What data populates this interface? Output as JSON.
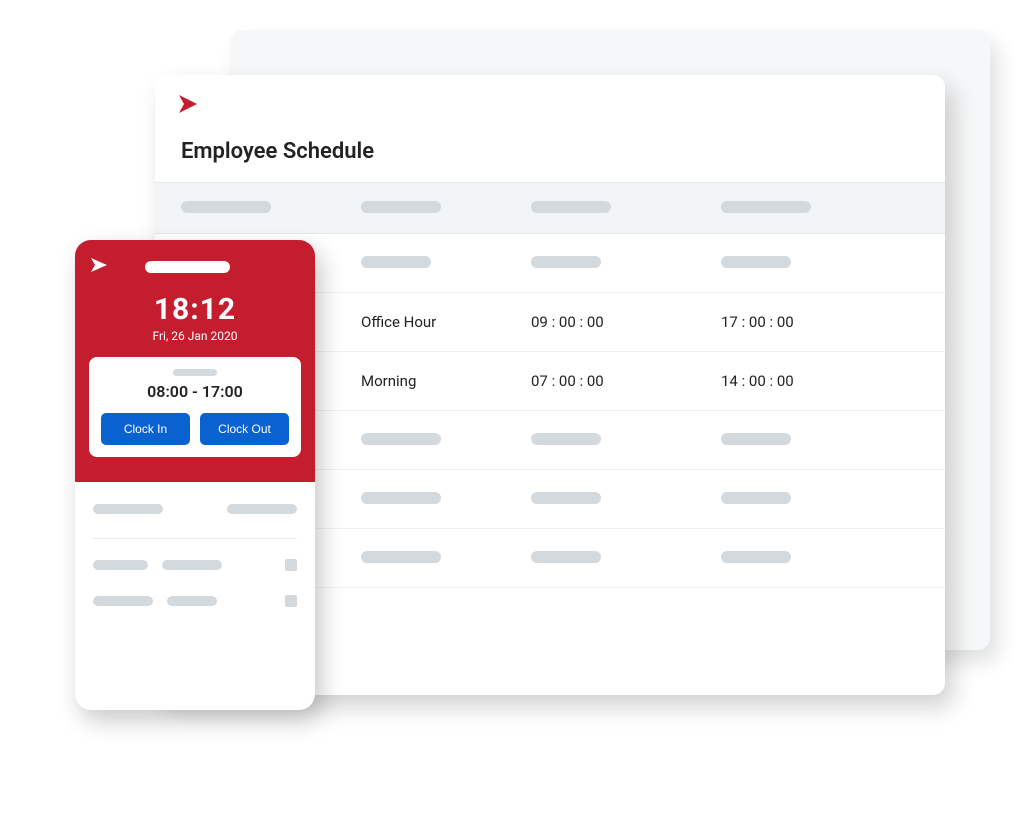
{
  "colors": {
    "accent_red": "#c41e2e",
    "button_blue": "#0a62d0",
    "placeholder_gray": "#d4d9dd"
  },
  "desktop": {
    "title": "Employee Schedule",
    "rows": [
      {
        "name": "Office Hour",
        "start": "09 : 00 : 00",
        "end": "17 : 00 : 00"
      },
      {
        "name": "Morning",
        "start": "07 : 00 : 00",
        "end": "14 : 00 : 00"
      }
    ]
  },
  "mobile": {
    "time": "18:12",
    "date": "Fri, 26 Jan 2020",
    "shift_range": "08:00 - 17:00",
    "clock_in_label": "Clock In",
    "clock_out_label": "Clock Out"
  }
}
